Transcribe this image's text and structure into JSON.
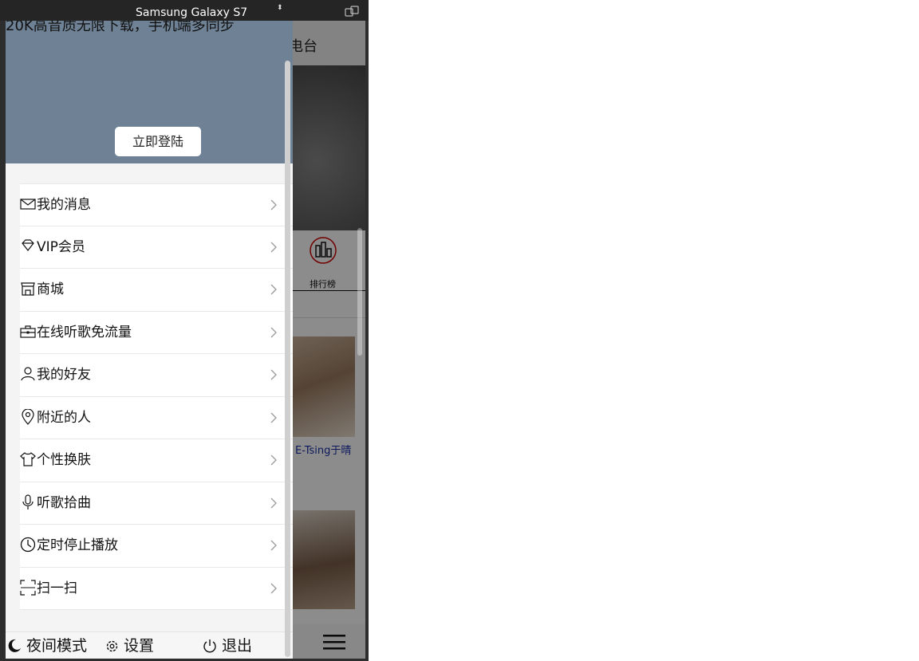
{
  "devtools": {
    "device_name": "Samsung Galaxy S7",
    "device_caret": "⬍"
  },
  "background": {
    "tab_radio": "电台",
    "rank_label": "排行榜",
    "artist_name": "E-Tsing于晴"
  },
  "drawer": {
    "promo_text": "20K高音质无限下载，手机端多同步",
    "login_label": "立即登陆",
    "menu": [
      {
        "label": "我的消息",
        "icon": "mail-icon"
      },
      {
        "label": "VIP会员",
        "icon": "diamond-icon"
      },
      {
        "label": "商城",
        "icon": "store-icon"
      },
      {
        "label": "在线听歌免流量",
        "icon": "toolbox-icon"
      },
      {
        "label": "我的好友",
        "icon": "user-icon"
      },
      {
        "label": "附近的人",
        "icon": "location-pin-icon"
      },
      {
        "label": "个性换肤",
        "icon": "tshirt-icon"
      },
      {
        "label": "听歌拾曲",
        "icon": "microphone-icon"
      },
      {
        "label": "定时停止播放",
        "icon": "clock-icon"
      },
      {
        "label": "扫一扫",
        "icon": "scan-icon"
      }
    ],
    "footer": {
      "night_mode": "夜间模式",
      "settings": "设置",
      "logout": "退出"
    }
  },
  "colors": {
    "drawer_header": "#6f8295",
    "artist_link": "#1a2fa8"
  }
}
